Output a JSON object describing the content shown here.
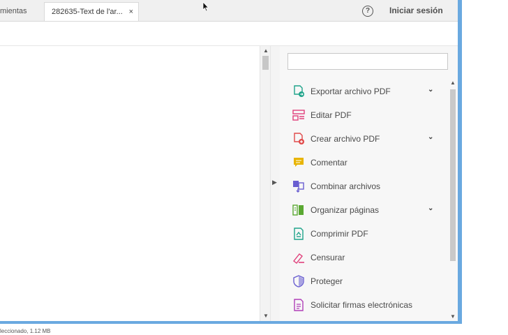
{
  "tabs": {
    "inactive_label": "mientas",
    "active_label": "282635-Text de l'ar...",
    "close_glyph": "×"
  },
  "header": {
    "help_glyph": "?",
    "signin_label": "Iniciar sesión"
  },
  "tools_panel": {
    "search_placeholder": "",
    "items": [
      {
        "label": "Exportar archivo PDF",
        "icon": "export-pdf-icon",
        "expandable": true
      },
      {
        "label": "Editar PDF",
        "icon": "edit-pdf-icon",
        "expandable": false
      },
      {
        "label": "Crear archivo PDF",
        "icon": "create-pdf-icon",
        "expandable": true
      },
      {
        "label": "Comentar",
        "icon": "comment-icon",
        "expandable": false
      },
      {
        "label": "Combinar archivos",
        "icon": "combine-files-icon",
        "expandable": false
      },
      {
        "label": "Organizar páginas",
        "icon": "organize-pages-icon",
        "expandable": true
      },
      {
        "label": "Comprimir PDF",
        "icon": "compress-pdf-icon",
        "expandable": false
      },
      {
        "label": "Censurar",
        "icon": "redact-icon",
        "expandable": false
      },
      {
        "label": "Proteger",
        "icon": "protect-icon",
        "expandable": false
      },
      {
        "label": "Solicitar firmas electrónicas",
        "icon": "request-signatures-icon",
        "expandable": false
      }
    ]
  },
  "status_bar": {
    "text": "leccionado, 1.12 MB"
  },
  "colors": {
    "window_frame": "#6aa9e0",
    "export": "#1fa38a",
    "edit": "#e0407b",
    "create": "#e04a4a",
    "comment": "#e8b400",
    "combine": "#6a5fd1",
    "organize": "#5aa832",
    "compress": "#1fa38a",
    "redact": "#e0407b",
    "protect": "#6a5fd1",
    "sign": "#b03fb8"
  }
}
